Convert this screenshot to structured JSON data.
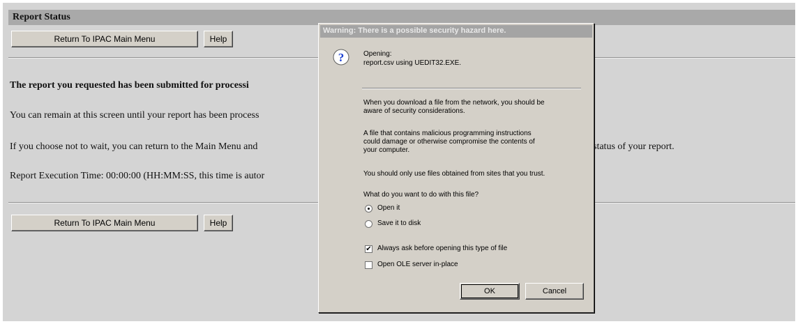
{
  "page": {
    "title": "Report Status",
    "return_button": "Return To IPAC Main Menu",
    "help_button": "Help",
    "heading": "The report you requested has been submitted for processi",
    "line1": "You can remain at this screen until your report has been process",
    "line2_left": "If you choose not to wait, you can return to the Main Menu and",
    "line2_right": "status of your report.",
    "line3": "Report Execution Time: 00:00:00 (HH:MM:SS, this time is autor",
    "bottom_return_button": "Return To IPAC Main Menu",
    "bottom_help_button": "Help"
  },
  "dialog": {
    "title": "Warning: There is a possible security hazard here.",
    "icon": "question-icon",
    "opening_label": "Opening:",
    "opening_file": "report.csv using UEDIT32.EXE.",
    "para1": [
      "When you download a file from the network, you should be",
      "aware of security considerations."
    ],
    "para2": [
      "A file that contains malicious programming instructions",
      "could damage or otherwise compromise the contents of",
      "your computer."
    ],
    "para3": "You should only use files obtained from sites that you trust.",
    "question": "What do you want to do with this file?",
    "options": [
      {
        "label": "Open it",
        "selected": true
      },
      {
        "label": "Save it to disk",
        "selected": false
      }
    ],
    "checkboxes": [
      {
        "label": "Always ask before opening this type of file",
        "checked": true
      },
      {
        "label": "Open OLE server in-place",
        "checked": false
      }
    ],
    "check_glyph": "✔",
    "ok_button": "OK",
    "cancel_button": "Cancel"
  },
  "colors": {
    "page_bg": "#d4d4d4",
    "title_bar": "#a9a9a9",
    "dialog_bg": "#d4d0c8",
    "icon_blue": "#1a3fd0"
  }
}
